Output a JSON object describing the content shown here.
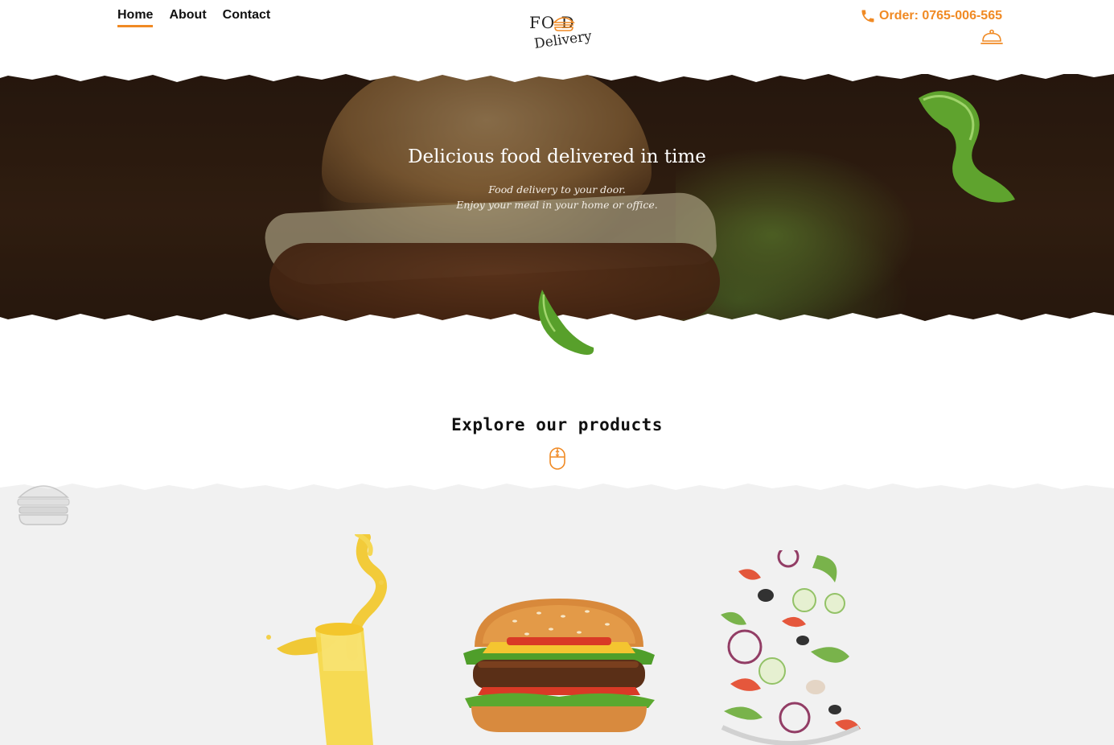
{
  "nav": {
    "items": [
      {
        "label": "Home",
        "active": true
      },
      {
        "label": "About",
        "active": false
      },
      {
        "label": "Contact",
        "active": false
      }
    ]
  },
  "logo": {
    "line1": "FO  D",
    "line2": "Delivery"
  },
  "header": {
    "order_label": "Order: 0765-006-565",
    "accent_color": "#f08a24"
  },
  "hero": {
    "title": "Delicious food delivered in time",
    "subtitle_line1": "Food delivery to your door.",
    "subtitle_line2": "Enjoy your meal in your home or office."
  },
  "explore": {
    "title": "Explore our products"
  },
  "icons": {
    "phone": "phone-icon",
    "cloche": "cloche-icon",
    "scroll": "mouse-scroll-icon"
  },
  "products": [
    {
      "name": "juice"
    },
    {
      "name": "burger"
    },
    {
      "name": "salad"
    }
  ]
}
